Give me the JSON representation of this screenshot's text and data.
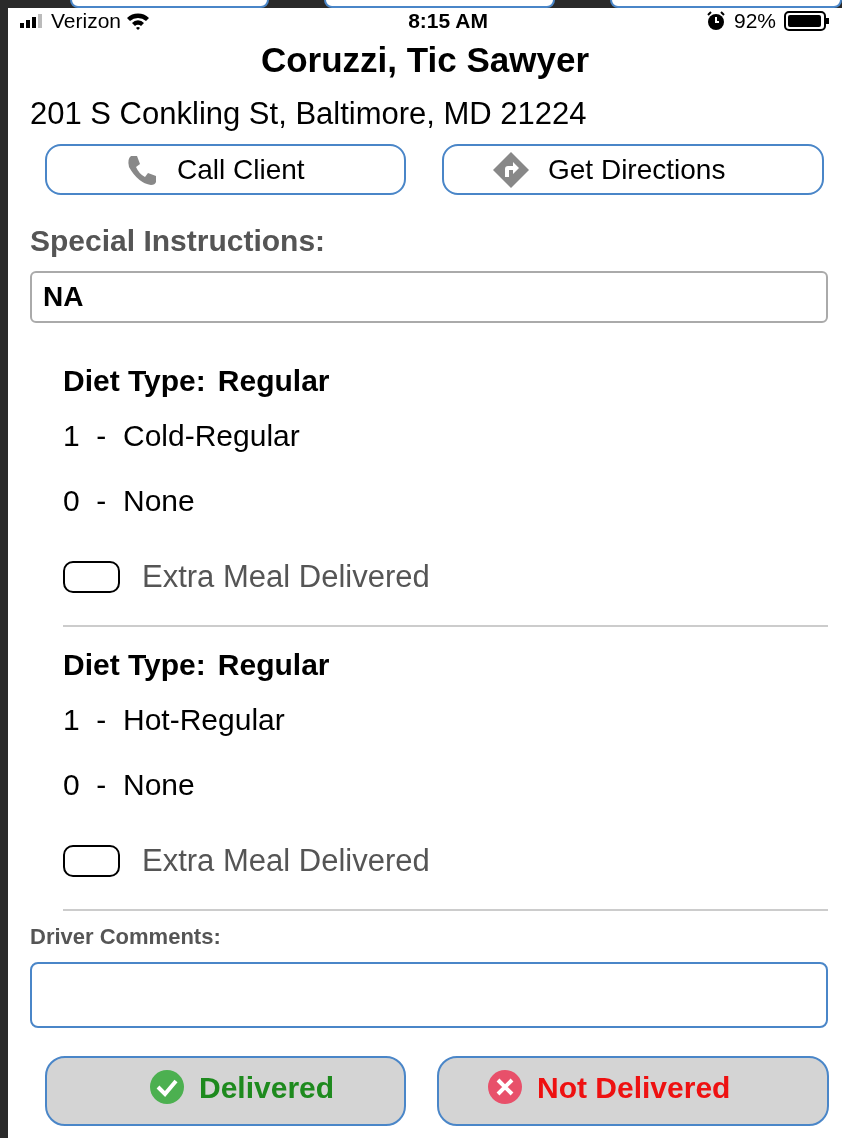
{
  "status_bar": {
    "carrier": "Verizon",
    "time": "8:15 AM",
    "battery": "92%"
  },
  "client": {
    "name": "Coruzzi, Tic Sawyer",
    "address": "201 S Conkling St, Baltimore, MD 21224"
  },
  "actions": [
    {
      "label": "Call Client",
      "kind": "call"
    },
    {
      "label": "Get Directions",
      "kind": "directions"
    }
  ],
  "special_instructions": {
    "label": "Special Instructions:",
    "value": "NA"
  },
  "diet_groups": [
    {
      "label": "Diet Type:",
      "value": "Regular",
      "items": [
        "1  -  Cold-Regular",
        "0  -  None"
      ],
      "extra_meal": {
        "label": "Extra Meal Delivered",
        "checked": false
      }
    },
    {
      "label": "Diet Type:",
      "value": "Regular",
      "items": [
        "1  -  Hot-Regular",
        "0  -  None"
      ],
      "extra_meal": {
        "label": "Extra Meal Delivered",
        "checked": false
      }
    }
  ],
  "driver_comments": {
    "label": "Driver Comments:"
  },
  "footer_buttons": [
    {
      "label": "Delivered",
      "kind": "delivered"
    },
    {
      "label": "Not Delivered",
      "kind": "not_delivered"
    }
  ]
}
